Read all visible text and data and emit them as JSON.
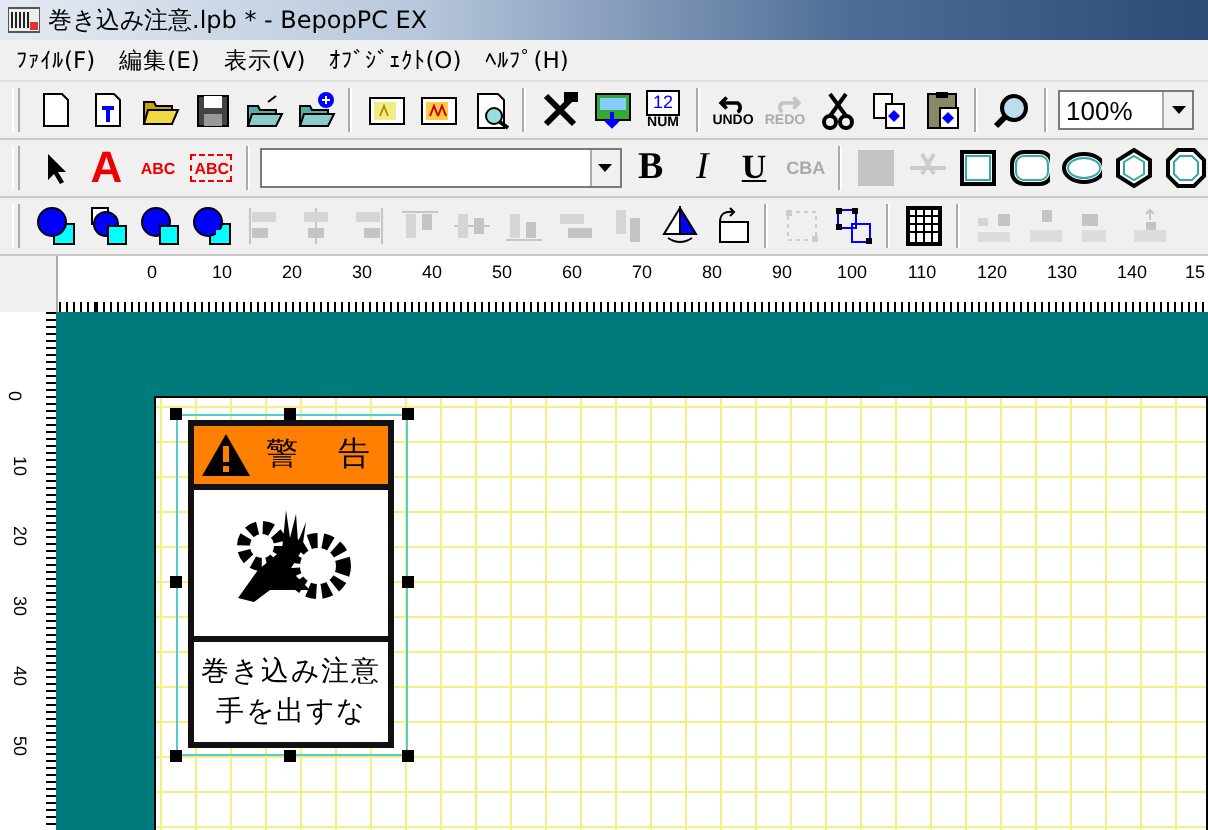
{
  "window": {
    "title": "巻き込み注意.lpb * - BepopPC EX"
  },
  "menu": [
    "ﾌｧｲﾙ(F)",
    "編集(E)",
    "表示(V)",
    "ｵﾌﾞｼﾞｪｸﾄ(O)",
    "ﾍﾙﾌﾟ(H)"
  ],
  "toolbars": [
    {
      "groups": [
        [
          {
            "kind": "new",
            "disabled": false
          },
          {
            "kind": "new-text",
            "disabled": false
          },
          {
            "kind": "open",
            "disabled": false
          },
          {
            "kind": "save",
            "disabled": false
          },
          {
            "kind": "open-arrow",
            "disabled": false
          },
          {
            "kind": "open-plus",
            "disabled": false
          }
        ],
        [
          {
            "kind": "frame-a",
            "disabled": false
          },
          {
            "kind": "frame-aa",
            "disabled": false
          },
          {
            "kind": "preview",
            "disabled": false
          }
        ],
        [
          {
            "kind": "tools",
            "disabled": false
          },
          {
            "kind": "image-import",
            "disabled": false
          },
          {
            "kind": "num",
            "label": "12",
            "sublabel": "NUM",
            "disabled": false
          }
        ],
        [
          {
            "kind": "undo",
            "label": "UNDO",
            "disabled": false
          },
          {
            "kind": "redo",
            "label": "REDO",
            "disabled": true
          },
          {
            "kind": "cut",
            "disabled": false
          },
          {
            "kind": "copy",
            "disabled": false
          },
          {
            "kind": "paste",
            "disabled": false
          }
        ],
        [
          {
            "kind": "zoom",
            "disabled": false
          }
        ],
        [
          {
            "kind": "combo",
            "value": "100%",
            "disabled": false
          }
        ]
      ]
    },
    {
      "groups": [
        [
          {
            "kind": "pointer",
            "disabled": false
          },
          {
            "kind": "text",
            "label": "A",
            "disabled": false
          },
          {
            "kind": "text-arc",
            "label": "ABC",
            "disabled": false
          },
          {
            "kind": "text-frame",
            "label": "ABC",
            "disabled": false
          }
        ],
        [
          {
            "kind": "combo",
            "disabled": false
          },
          {
            "kind": "bold",
            "label": "B",
            "disabled": false
          },
          {
            "kind": "italic",
            "label": "I",
            "disabled": false
          },
          {
            "kind": "underline",
            "label": "U",
            "disabled": false
          },
          {
            "kind": "reverse",
            "label": "CBA",
            "disabled": true
          }
        ],
        [
          {
            "kind": "fill",
            "disabled": true
          },
          {
            "kind": "line-cut",
            "disabled": true
          },
          {
            "kind": "rect",
            "disabled": false
          },
          {
            "kind": "roundrect",
            "disabled": false
          },
          {
            "kind": "ellipse",
            "disabled": false
          },
          {
            "kind": "hexagon",
            "disabled": false
          },
          {
            "kind": "octagon",
            "disabled": false
          }
        ]
      ]
    },
    {
      "groups": [
        [
          {
            "kind": "layer-front",
            "disabled": false
          },
          {
            "kind": "layer-back",
            "disabled": false
          },
          {
            "kind": "layer-forward",
            "disabled": false
          },
          {
            "kind": "layer-backward",
            "disabled": false
          },
          {
            "kind": "align-left",
            "disabled": true
          },
          {
            "kind": "align-center",
            "disabled": true
          },
          {
            "kind": "align-right",
            "disabled": true
          },
          {
            "kind": "align-top",
            "disabled": true
          },
          {
            "kind": "align-middle",
            "disabled": true
          },
          {
            "kind": "align-bottom",
            "disabled": true
          },
          {
            "kind": "distribute-h",
            "disabled": true
          },
          {
            "kind": "distribute-v",
            "disabled": true
          },
          {
            "kind": "flip",
            "disabled": false
          },
          {
            "kind": "rotate",
            "disabled": false
          }
        ],
        [
          {
            "kind": "group",
            "disabled": true
          },
          {
            "kind": "ungroup",
            "disabled": false
          }
        ],
        [
          {
            "kind": "grid",
            "disabled": false
          }
        ],
        [
          {
            "kind": "space-left",
            "disabled": true
          },
          {
            "kind": "space-down",
            "disabled": true
          },
          {
            "kind": "space-right",
            "disabled": true
          },
          {
            "kind": "space-up",
            "disabled": true
          }
        ]
      ]
    }
  ],
  "ruler_top": {
    "labels": [
      "0",
      "10",
      "20",
      "30",
      "40",
      "50",
      "60",
      "70",
      "80",
      "90",
      "100",
      "110",
      "120",
      "130",
      "140",
      "15"
    ]
  },
  "ruler_left": {
    "labels": [
      "0",
      "10",
      "20",
      "30",
      "40",
      "50"
    ]
  },
  "sign": {
    "header": "警　告",
    "lines": [
      "巻き込み注意",
      "手を出すな"
    ]
  }
}
